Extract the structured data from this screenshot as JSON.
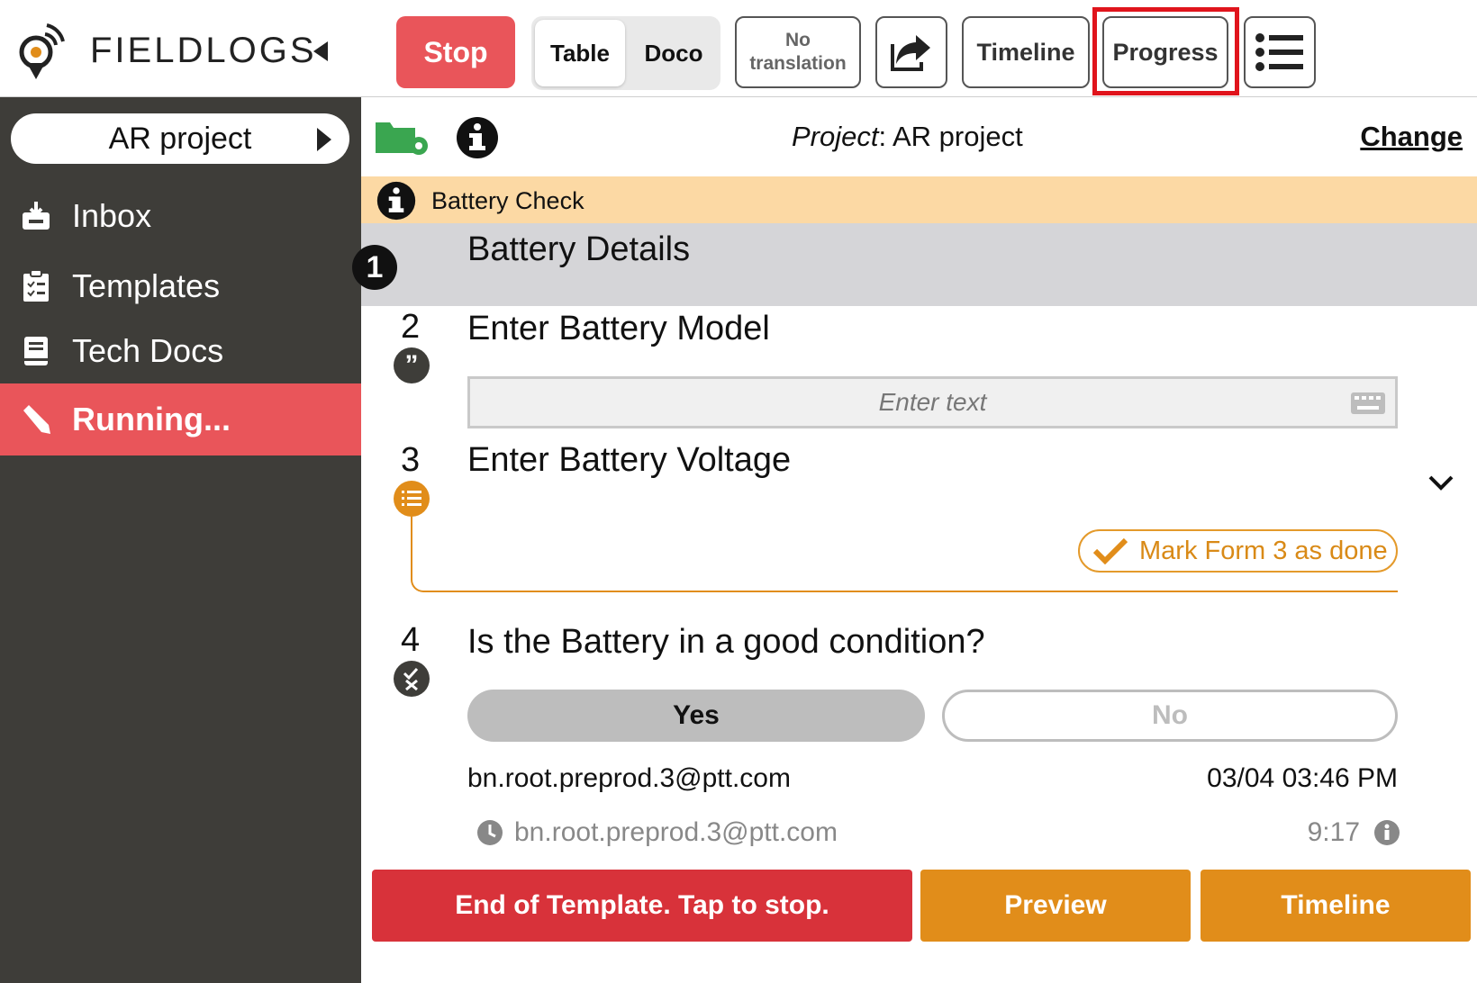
{
  "app": {
    "logo_text": "FIELDLOGS"
  },
  "toolbar": {
    "stop_label": "Stop",
    "table_label": "Table",
    "doco_label": "Doco",
    "no_translation_line1": "No",
    "no_translation_line2": "translation",
    "timeline_label": "Timeline",
    "progress_label": "Progress"
  },
  "sidebar": {
    "project_name": "AR project",
    "items": [
      {
        "label": "Inbox",
        "icon": "inbox-icon"
      },
      {
        "label": "Templates",
        "icon": "clipboard-icon"
      },
      {
        "label": "Tech Docs",
        "icon": "book-icon"
      },
      {
        "label": "Running...",
        "icon": "pencil-icon"
      }
    ]
  },
  "project_bar": {
    "prefix": "Project",
    "name": ": AR project",
    "change_label": "Change"
  },
  "banner": {
    "text": "Battery Check"
  },
  "steps": {
    "s1": {
      "num": "1",
      "title": "Battery Details"
    },
    "s2": {
      "num": "2",
      "title": "Enter Battery Model",
      "placeholder": "Enter text"
    },
    "s3": {
      "num": "3",
      "title": "Enter Battery Voltage",
      "mark_done": "Mark Form 3 as done"
    },
    "s4": {
      "num": "4",
      "title": "Is the Battery in a good condition?",
      "yes": "Yes",
      "no": "No"
    }
  },
  "response": {
    "user": "bn.root.preprod.3@ptt.com",
    "time": "03/04 03:46 PM",
    "history_user": "bn.root.preprod.3@ptt.com",
    "history_time": "9:17"
  },
  "bottom": {
    "end_label": "End of Template. Tap to stop.",
    "preview_label": "Preview",
    "timeline_label": "Timeline"
  },
  "colors": {
    "accent_red": "#e9555a",
    "sidebar_bg": "#3e3d39",
    "orange": "#e18d1a",
    "highlight": "#e0141c",
    "banner": "#fcd9a4"
  }
}
